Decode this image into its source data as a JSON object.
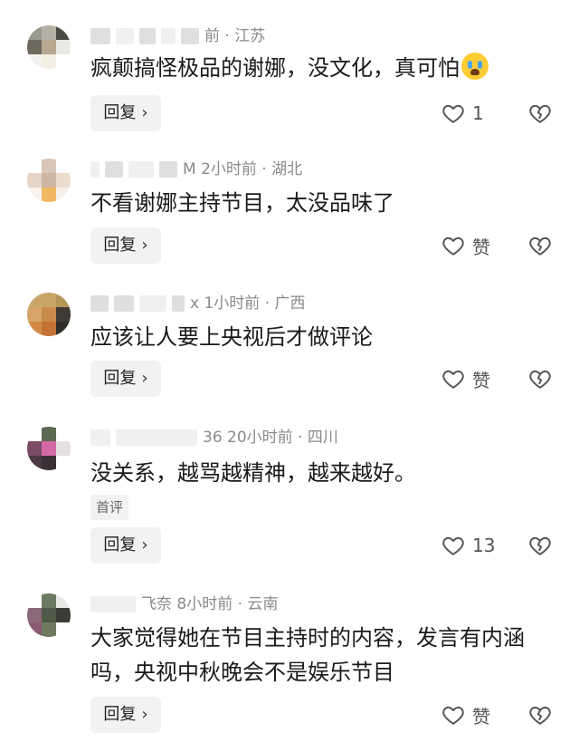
{
  "comments": [
    {
      "meta": "前 · 江苏",
      "text": "疯颠搞怪极品的谢娜，没文化，真可怕",
      "emoji": "loudly-crying-face",
      "reply_label": "回复",
      "like_count": "1"
    },
    {
      "meta": "M  2小时前 · 湖北",
      "text": "不看谢娜主持节目，太没品味了",
      "reply_label": "回复",
      "like_count": "赞"
    },
    {
      "meta": "x  1小时前 · 广西",
      "text": "应该让人要上央视后才做评论",
      "reply_label": "回复",
      "like_count": "赞"
    },
    {
      "meta": "36  20小时前 · 四川",
      "text": "没关系，越骂越精神，越来越好。",
      "tag": "首评",
      "reply_label": "回复",
      "like_count": "13"
    },
    {
      "meta": "飞奈  8小时前 · 云南",
      "text": "大家觉得她在节目主持时的内容，发言有内涵吗，央视中秋晚会不是娱乐节目",
      "reply_label": "回复",
      "like_count": "赞"
    }
  ],
  "icons": {
    "like": "heart-outline-icon",
    "dislike": "broken-heart-icon",
    "reply_chevron": "chevron-right-icon"
  },
  "colors": {
    "text": "#1a1a1a",
    "meta": "#8a8a8a",
    "button_bg": "#f2f2f2"
  }
}
